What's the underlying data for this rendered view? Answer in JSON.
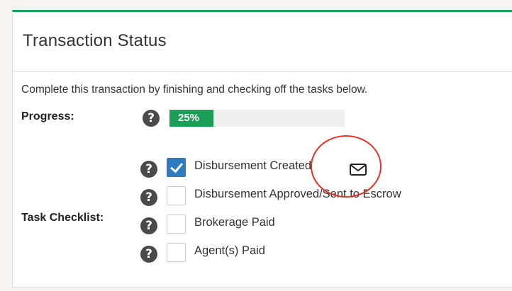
{
  "panel": {
    "title": "Transaction Status",
    "intro": "Complete this transaction by finishing and checking off the tasks below.",
    "accent_color": "#19a35b"
  },
  "progress": {
    "label": "Progress:",
    "percent": 25,
    "text": "25%",
    "help_glyph": "?",
    "fill_color": "#1b9e55"
  },
  "checklist": {
    "label": "Task Checklist:",
    "help_glyph": "?",
    "items": [
      {
        "label": "Disbursement Created",
        "checked": true,
        "icon": "mail-icon"
      },
      {
        "label": "Disbursement Approved/Sent to Escrow",
        "checked": false
      },
      {
        "label": "Brokerage Paid",
        "checked": false
      },
      {
        "label": "Agent(s) Paid",
        "checked": false
      }
    ]
  },
  "annotation": {
    "type": "red-circle-highlight",
    "target": "mail-icon",
    "color": "#e4332a"
  }
}
